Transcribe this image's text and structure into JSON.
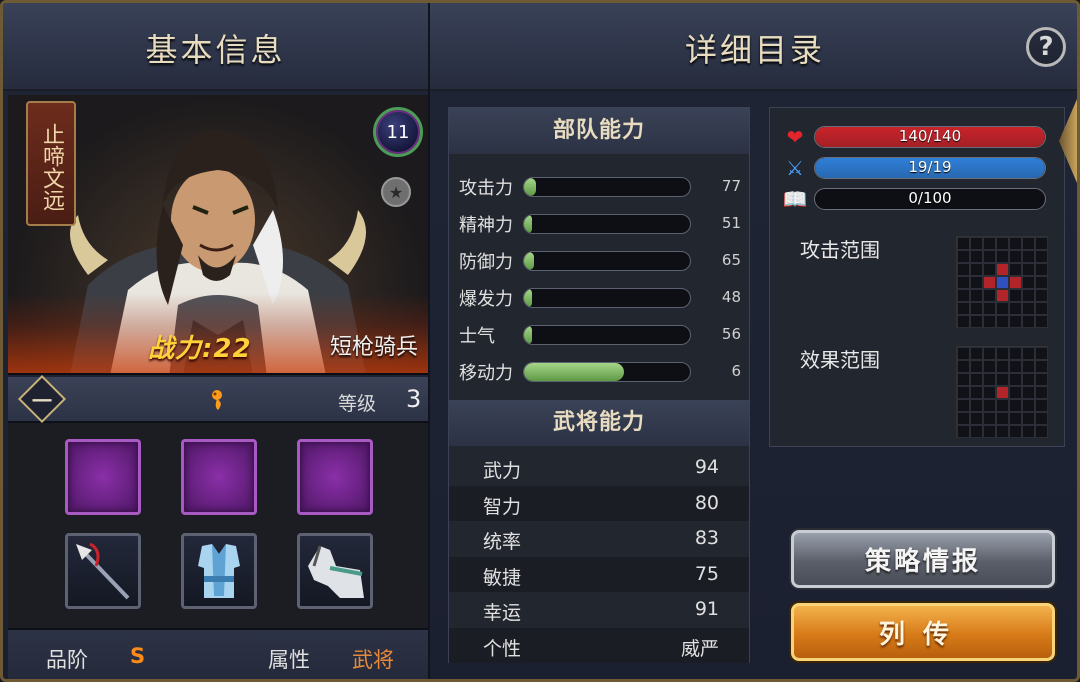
{
  "header": {
    "left_title": "基本信息",
    "right_title": "详细目录",
    "help_label": "?"
  },
  "portrait": {
    "name": "止啼文远",
    "level_badge": "11",
    "power_text": "战力:22",
    "unit_type": "短枪骑兵"
  },
  "level_row": {
    "rank": "一",
    "level_label": "等级",
    "level_value": "3"
  },
  "equipment": {
    "slots": [
      "purple-slot",
      "purple-slot",
      "purple-slot"
    ],
    "items": [
      "spear-icon",
      "armor-icon",
      "horse-icon"
    ]
  },
  "grade_row": {
    "grade_label": "品阶",
    "grade_value": "S",
    "attr_label": "属性",
    "attr_value": "武将"
  },
  "troop_section": {
    "title": "部队能力",
    "stats": [
      {
        "label": "攻击力",
        "value": "77",
        "fill": 0.07
      },
      {
        "label": "精神力",
        "value": "51",
        "fill": 0.05
      },
      {
        "label": "防御力",
        "value": "65",
        "fill": 0.06
      },
      {
        "label": "爆发力",
        "value": "48",
        "fill": 0.05
      },
      {
        "label": "士气",
        "value": "56",
        "fill": 0.05
      },
      {
        "label": "移动力",
        "value": "6",
        "fill": 0.6
      }
    ]
  },
  "general_section": {
    "title": "武将能力",
    "stats": [
      {
        "label": "武力",
        "value": "94"
      },
      {
        "label": "智力",
        "value": "80"
      },
      {
        "label": "统率",
        "value": "83"
      },
      {
        "label": "敏捷",
        "value": "75"
      },
      {
        "label": "幸运",
        "value": "91"
      },
      {
        "label": "个性",
        "value": "威严"
      }
    ]
  },
  "resources": {
    "hp": {
      "text": "140/140",
      "fill": 1.0,
      "color": "#c8242a",
      "icon": "heart-icon"
    },
    "mp": {
      "text": "19/19",
      "fill": 1.0,
      "color": "#2f7fd8",
      "icon": "crossed-swords-icon"
    },
    "exp": {
      "text": "0/100",
      "fill": 0.0,
      "color": "#e0b040",
      "icon": "book-icon"
    }
  },
  "ranges": {
    "attack_label": "攻击范围",
    "effect_label": "效果范围"
  },
  "buttons": {
    "strategy": "策略情报",
    "biography": "列传"
  },
  "colors": {
    "gold_text": "#e8dcc0",
    "grade": "#ff8c1a",
    "attr": "#e88a3a"
  }
}
